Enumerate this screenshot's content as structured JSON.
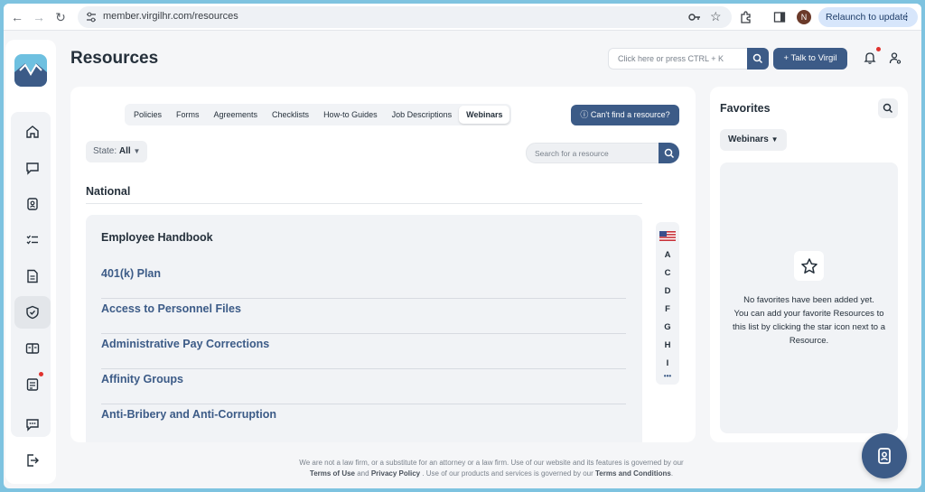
{
  "browser": {
    "url": "member.virgilhr.com/resources",
    "relaunch_label": "Relaunch to update",
    "profile_initial": "N"
  },
  "header": {
    "title": "Resources",
    "search_placeholder": "Click here or press CTRL + K",
    "talk_button": "Talk to Virgil"
  },
  "tabs": [
    "Policies",
    "Forms",
    "Agreements",
    "Checklists",
    "How-to Guides",
    "Job Descriptions",
    "Webinars"
  ],
  "active_tab": "Webinars",
  "cant_find_button": "Can't find a resource?",
  "state_filter": {
    "label": "State:",
    "value": "All"
  },
  "resource_search_placeholder": "Search for a resource",
  "section": "National",
  "list_header": "Employee Handbook",
  "resources": [
    "401(k) Plan",
    "Access to Personnel Files",
    "Administrative Pay Corrections",
    "Affinity Groups",
    "Anti-Bribery and Anti-Corruption"
  ],
  "alphabet": [
    "A",
    "C",
    "D",
    "F",
    "G",
    "H",
    "I",
    "•••"
  ],
  "favorites": {
    "title": "Favorites",
    "filter": "Webinars",
    "empty_line1": "No favorites have been added yet.",
    "empty_line2": "You can add your favorite Resources to this list by clicking the star icon next to a Resource."
  },
  "footer": {
    "text1": "We are not a law firm, or a substitute for an attorney or a law firm. Use of our website and its features is governed by our",
    "terms_of_use": "Terms of Use",
    "and": "and",
    "privacy_policy": "Privacy Policy",
    "text2": ". Use of our products and services is governed by our",
    "terms_conditions": "Terms and Conditions",
    "end": "."
  },
  "colors": {
    "primary": "#3c5b87",
    "accent": "#6ec0e0",
    "alert": "#e0322e"
  }
}
